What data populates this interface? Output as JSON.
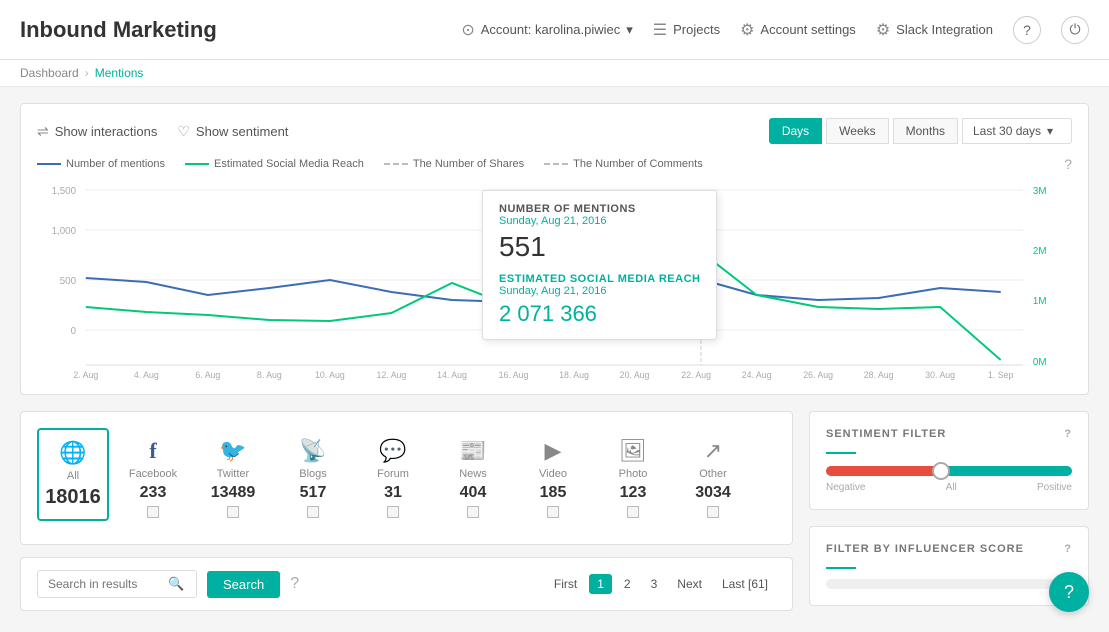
{
  "app": {
    "title": "Inbound Marketing"
  },
  "header": {
    "account_label": "Account: karolina.piwiec",
    "projects_label": "Projects",
    "settings_label": "Account settings",
    "slack_label": "Slack Integration"
  },
  "breadcrumb": {
    "home": "Dashboard",
    "current": "Mentions"
  },
  "chart_controls": {
    "show_interactions": "Show interactions",
    "show_sentiment": "Show sentiment",
    "days_btn": "Days",
    "weeks_btn": "Weeks",
    "months_btn": "Months",
    "range_label": "Last 30 days"
  },
  "chart": {
    "legend": [
      {
        "label": "Number of mentions",
        "color": "blue"
      },
      {
        "label": "Estimated Social Media Reach",
        "color": "green"
      },
      {
        "label": "The Number of Shares",
        "color": "gray"
      },
      {
        "label": "The Number of Comments",
        "color": "gray2"
      }
    ],
    "y_left": [
      "1,500",
      "1,000",
      "500",
      "0"
    ],
    "y_right": [
      "3M",
      "2M",
      "1M",
      "0M"
    ],
    "x_labels": [
      "2. Aug",
      "4. Aug",
      "6. Aug",
      "8. Aug",
      "10. Aug",
      "12. Aug",
      "14. Aug",
      "16. Aug",
      "18. Aug",
      "20. Aug",
      "22. Aug",
      "24. Aug",
      "26. Aug",
      "28. Aug",
      "30. Aug",
      "1. Sep"
    ]
  },
  "tooltip": {
    "title1": "NUMBER OF MENTIONS",
    "date1": "Sunday, Aug 21, 2016",
    "value1": "551",
    "title2": "ESTIMATED SOCIAL MEDIA REACH",
    "date2": "Sunday, Aug 21, 2016",
    "value2": "2 071 366"
  },
  "sources": [
    {
      "id": "all",
      "icon": "🌐",
      "label": "All",
      "count": "18016",
      "selected": true
    },
    {
      "id": "facebook",
      "icon": "f",
      "label": "Facebook",
      "count": "233",
      "selected": false
    },
    {
      "id": "twitter",
      "icon": "🐦",
      "label": "Twitter",
      "count": "13489",
      "selected": false
    },
    {
      "id": "blogs",
      "icon": "📡",
      "label": "Blogs",
      "count": "517",
      "selected": false
    },
    {
      "id": "forum",
      "icon": "💬",
      "label": "Forum",
      "count": "31",
      "selected": false
    },
    {
      "id": "news",
      "icon": "📰",
      "label": "News",
      "count": "404",
      "selected": false
    },
    {
      "id": "video",
      "icon": "▶",
      "label": "Video",
      "count": "185",
      "selected": false
    },
    {
      "id": "photo",
      "icon": "🖼",
      "label": "Photo",
      "count": "123",
      "selected": false
    },
    {
      "id": "other",
      "icon": "↗",
      "label": "Other",
      "count": "3034",
      "selected": false
    }
  ],
  "search": {
    "placeholder": "Search in results",
    "button_label": "Search",
    "first_label": "First",
    "next_label": "Next",
    "last_label": "Last [61]",
    "pages": [
      "1",
      "2",
      "3"
    ]
  },
  "sentiment": {
    "title": "SENTIMENT FILTER",
    "negative_label": "Negative",
    "all_label": "All",
    "positive_label": "Positive"
  },
  "influencer": {
    "title": "FILTER BY INFLUENCER SCORE"
  },
  "help": {
    "label": "?"
  }
}
